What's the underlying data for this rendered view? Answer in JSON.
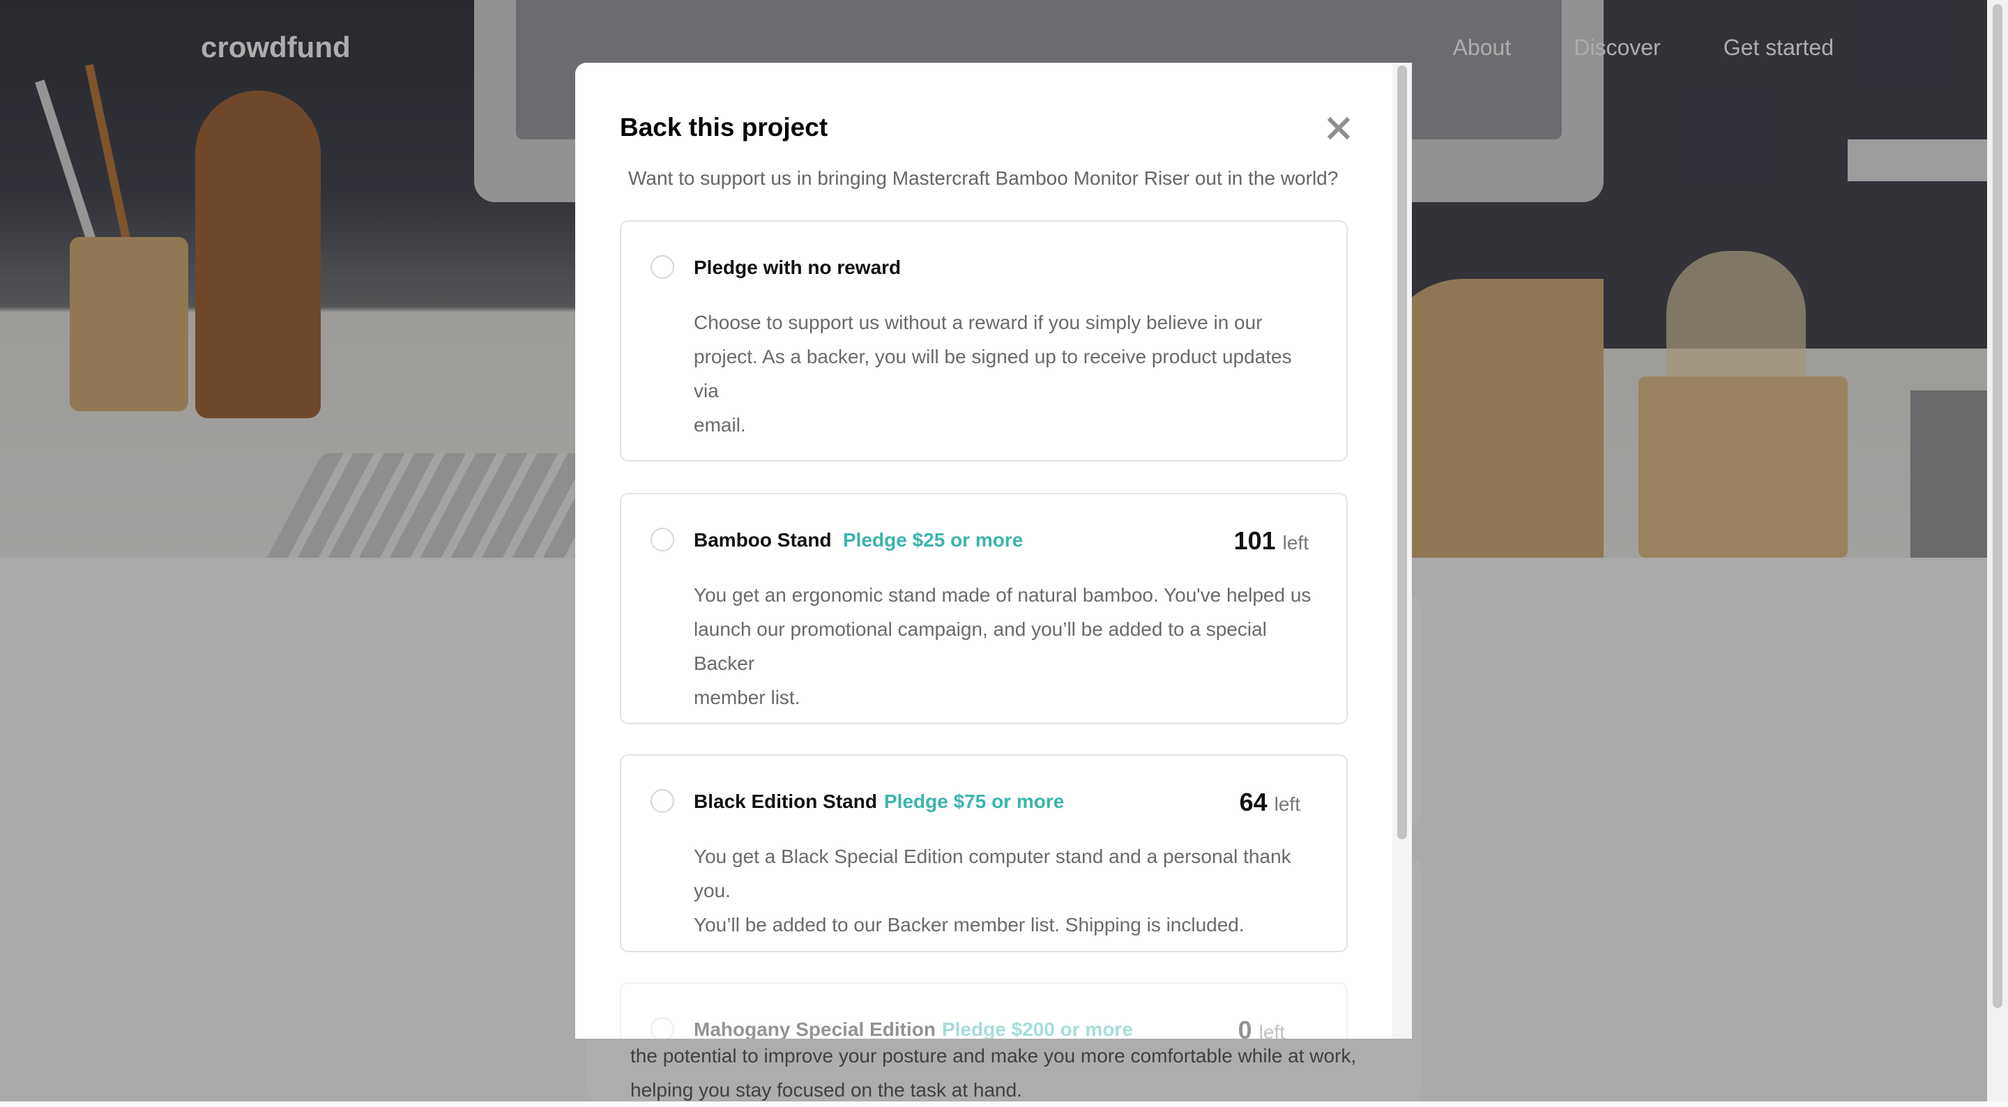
{
  "brand": {
    "name": "crowdfund"
  },
  "nav": {
    "items": [
      "About",
      "Discover",
      "Get started"
    ]
  },
  "background_text": {
    "line1": "the potential to improve your posture and make you more comfortable while at work,",
    "line2": "helping you stay focused on the task at hand."
  },
  "modal": {
    "title": "Back this project",
    "close_icon": "close-icon",
    "intro": "Want to support us in bringing Mastercraft Bamboo Monitor Riser out in the world?",
    "pledges": [
      {
        "name": "Pledge with no reward",
        "price": "",
        "left_count": "",
        "left_label": "",
        "description_lines": [
          "Choose to support us without a reward if you simply believe in our",
          "project. As a backer, you will be signed up to receive product updates via",
          "email."
        ]
      },
      {
        "name": "Bamboo Stand",
        "price": "Pledge $25 or more",
        "left_count": "101",
        "left_label": "left",
        "description_lines": [
          "You get an ergonomic stand made of natural bamboo. You've helped us",
          "launch our promotional campaign, and you’ll be added to a special Backer",
          "member list."
        ]
      },
      {
        "name": "Black Edition Stand",
        "price": "Pledge $75 or more",
        "left_count": "64",
        "left_label": "left",
        "description_lines": [
          "You get a Black Special Edition computer stand and a personal thank you.",
          "You’ll be added to our Backer member list. Shipping is included."
        ]
      },
      {
        "name": "Mahogany Special Edition",
        "price": "Pledge $200 or more",
        "left_count": "0",
        "left_label": "left",
        "description_lines": []
      }
    ]
  },
  "colors": {
    "accent": "#3cb4ac",
    "overlay": "rgba(0,0,0,0.32)"
  }
}
